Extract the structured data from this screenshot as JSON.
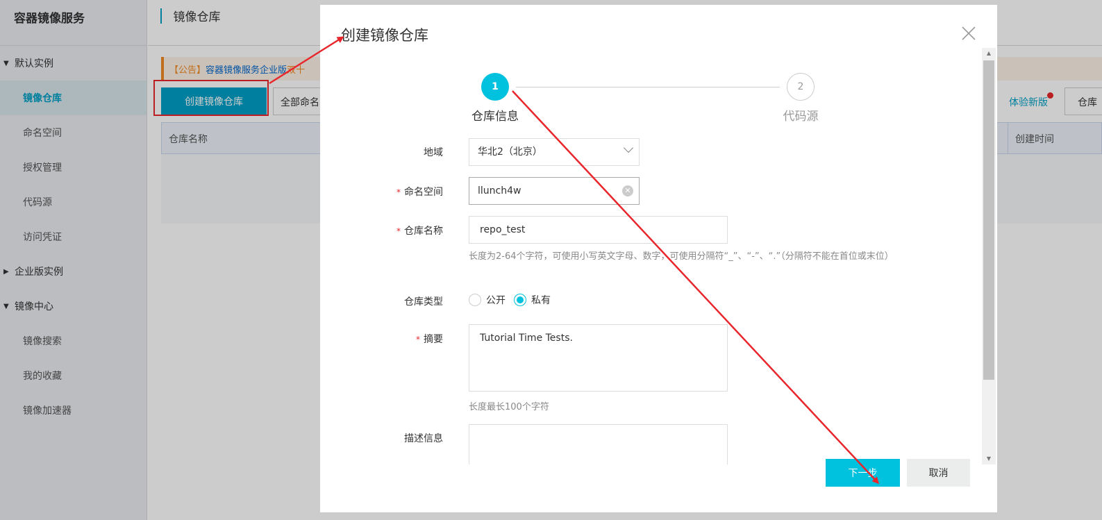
{
  "sidebar": {
    "brand": "容器镜像服务",
    "groups": [
      {
        "label": "默认实例",
        "expanded": true,
        "items": [
          {
            "label": "镜像仓库",
            "active": true
          },
          {
            "label": "命名空间",
            "active": false
          },
          {
            "label": "授权管理",
            "active": false
          },
          {
            "label": "代码源",
            "active": false
          },
          {
            "label": "访问凭证",
            "active": false
          }
        ]
      },
      {
        "label": "企业版实例",
        "expanded": false,
        "items": []
      },
      {
        "label": "镜像中心",
        "expanded": true,
        "items": [
          {
            "label": "镜像搜索",
            "active": false
          },
          {
            "label": "我的收藏",
            "active": false
          },
          {
            "label": "镜像加速器",
            "active": false
          }
        ]
      }
    ]
  },
  "main": {
    "title": "镜像仓库",
    "notice": {
      "tag": "【公告】",
      "link": "容器镜像服务企业版",
      "highlight": "双十"
    },
    "create_button": "创建镜像仓库",
    "namespace_filter": "全部命名空间",
    "try_new_version": "体验新版",
    "repo_button": "仓库",
    "table": {
      "columns": [
        "仓库名称",
        "创建时间"
      ]
    }
  },
  "modal": {
    "title": "创建镜像仓库",
    "steps": [
      {
        "number": "1",
        "label": "仓库信息",
        "active": true
      },
      {
        "number": "2",
        "label": "代码源",
        "active": false
      }
    ],
    "form": {
      "region": {
        "label": "地域",
        "value": "华北2（北京）",
        "required": false
      },
      "namespace": {
        "label": "命名空间",
        "value": "llunch4w",
        "required": true
      },
      "repo_name": {
        "label": "仓库名称",
        "value": "repo_test",
        "required": true,
        "help": "长度为2-64个字符，可使用小写英文字母、数字，可使用分隔符“_”、“-”、“.”（分隔符不能在首位或末位）"
      },
      "repo_type": {
        "label": "仓库类型",
        "options": [
          {
            "label": "公开",
            "checked": false
          },
          {
            "label": "私有",
            "checked": true
          }
        ]
      },
      "summary": {
        "label": "摘要",
        "value": "Tutorial Time Tests.",
        "required": true,
        "help": "长度最长100个字符"
      },
      "description": {
        "label": "描述信息",
        "value": ""
      }
    },
    "buttons": {
      "next": "下一步",
      "cancel": "取消"
    }
  },
  "colors": {
    "accent": "#00c1de",
    "annotation": "#e8262c",
    "required": "#e8262c"
  }
}
